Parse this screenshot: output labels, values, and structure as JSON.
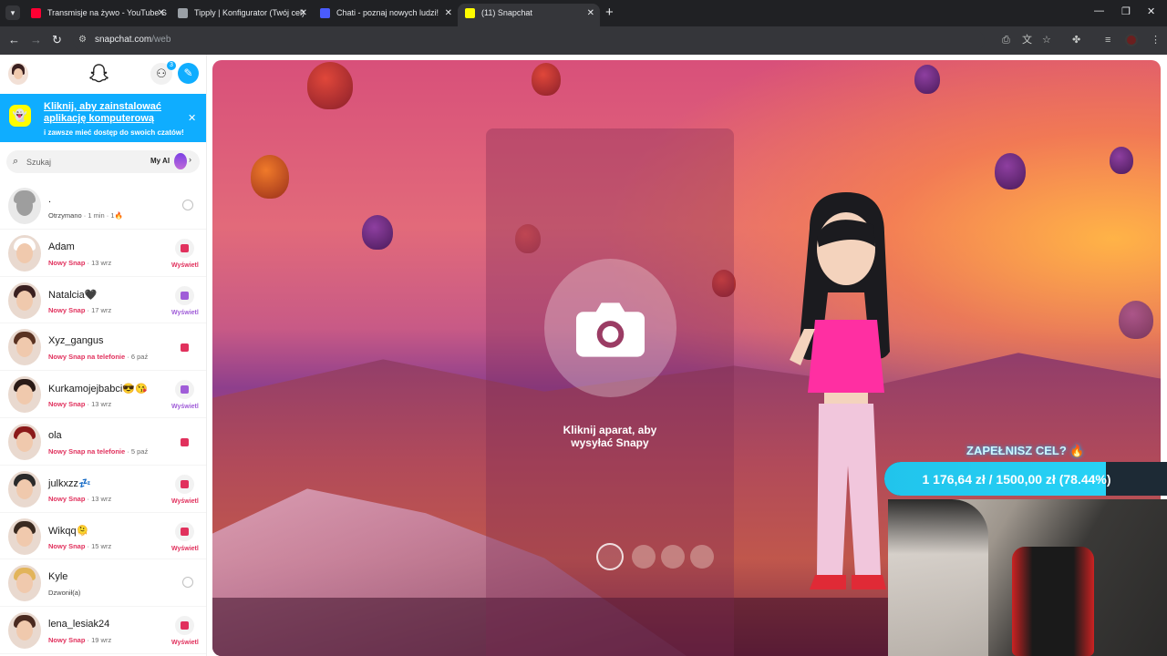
{
  "browser": {
    "tabs": [
      {
        "title": "Transmisje na żywo - YouTube S",
        "favicon_color": "#ff0033",
        "active": false
      },
      {
        "title": "Tipply | Konfigurator (Twój cel)",
        "favicon_color": "#9aa0a6",
        "active": false
      },
      {
        "title": "Chati - poznaj nowych ludzi!",
        "favicon_color": "#4a5cff",
        "active": false
      },
      {
        "title": "(11) Snapchat",
        "favicon_color": "#fffc00",
        "active": true
      }
    ],
    "url_host": "snapchat.com",
    "url_path": "/web"
  },
  "sidebar": {
    "add_friend_badge": "3",
    "banner": {
      "title": "Kliknij, aby zainstalować aplikację komputerową",
      "subtitle": "i zawsze mieć dostęp do swoich czatów!"
    },
    "search": {
      "placeholder": "Szukaj",
      "my_ai_label": "My AI"
    },
    "chats": [
      {
        "name": ".",
        "status": "Otrzymano",
        "time": "1 min",
        "streak": "1🔥",
        "indicator": "camera",
        "status_style": "gray"
      },
      {
        "name": "Adam",
        "status": "Nowy Snap",
        "time": "13 wrz",
        "indicator": "red",
        "view_label": "Wyświetl"
      },
      {
        "name": "Natalcia🖤",
        "status": "Nowy Snap",
        "time": "17 wrz",
        "indicator": "purple",
        "view_label": "Wyświetl"
      },
      {
        "name": "Xyz_gangus",
        "status": "Nowy Snap na telefonie",
        "time": "6 paź",
        "indicator": "red-plain"
      },
      {
        "name": "Kurkamojejbabci😎😘",
        "status": "Nowy Snap",
        "time": "13 wrz",
        "indicator": "purple",
        "view_label": "Wyświetl"
      },
      {
        "name": "ola",
        "status": "Nowy Snap na telefonie",
        "time": "5 paź",
        "indicator": "red-plain"
      },
      {
        "name": "julkxzz💤",
        "status": "Nowy Snap",
        "time": "13 wrz",
        "indicator": "red",
        "view_label": "Wyświetl"
      },
      {
        "name": "Wikqq🫠",
        "status": "Nowy Snap",
        "time": "15 wrz",
        "indicator": "red",
        "view_label": "Wyświetl"
      },
      {
        "name": "Kyle",
        "status": "Dzwonił(a)",
        "time": "",
        "indicator": "camera",
        "status_style": "gray"
      },
      {
        "name": "lena_lesiak24",
        "status": "Nowy Snap",
        "time": "19 wrz",
        "indicator": "red",
        "view_label": "Wyświetl"
      }
    ]
  },
  "camera": {
    "hint": "Kliknij aparat, aby wysyłać Snapy"
  },
  "stream_overlay": {
    "goal_title": "ZAPEŁNISZ CEL? 🔥",
    "goal_text": "1 176,64 zł / 1500,00 zł (78.44%)",
    "goal_fraction": 0.7844
  },
  "colors": {
    "snap_blue": "#0fadff",
    "snap_red": "#e1315d",
    "snap_purple": "#a05dd8",
    "snap_yellow": "#fffc00"
  }
}
